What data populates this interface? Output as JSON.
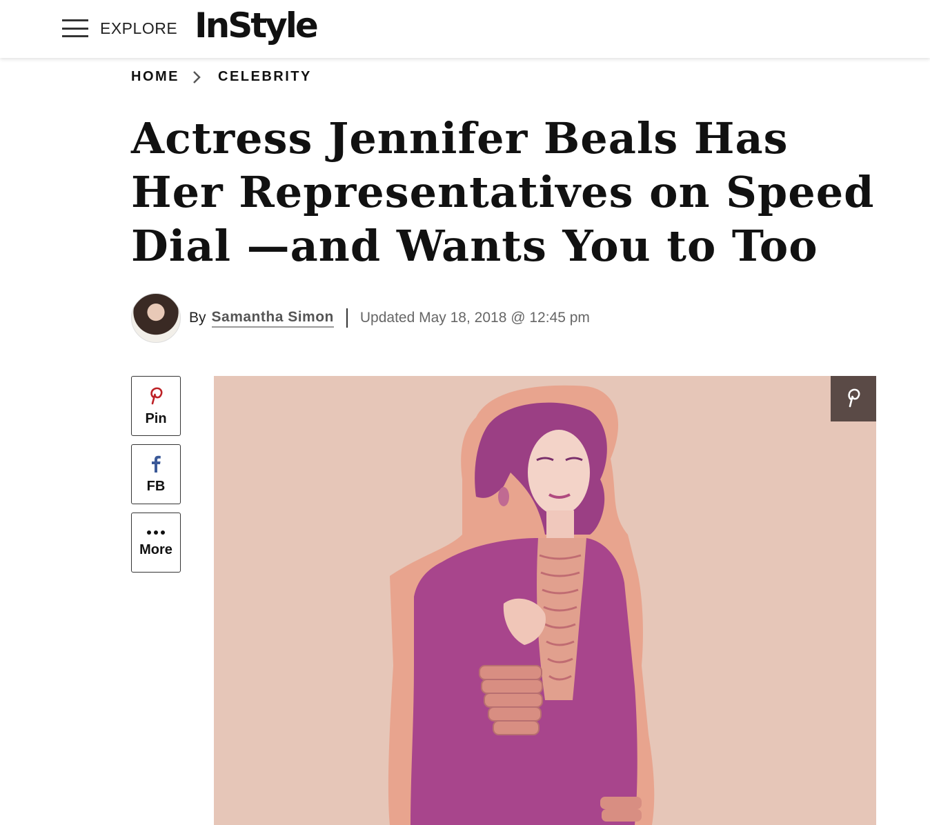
{
  "header": {
    "explore_label": "EXPLORE",
    "logo_text": "InStyle"
  },
  "breadcrumb": {
    "home": "HOME",
    "section": "CELEBRITY"
  },
  "article": {
    "headline": "Actress Jennifer Beals Has Her Representatives on Speed Dial —and Wants You to Too",
    "by_prefix": "By",
    "author": "Samantha Simon",
    "updated": "Updated May 18, 2018 @ 12:45 pm"
  },
  "share": {
    "pin_label": "Pin",
    "fb_label": "FB",
    "more_label": "More"
  },
  "colors": {
    "pinterest": "#bd2126",
    "facebook": "#3b5998",
    "hero_bg": "#e6c6b8",
    "figure_magenta": "#a8458c",
    "pin_overlay": "#5a4a46"
  },
  "icons": {
    "menu": "hamburger-icon",
    "breadcrumb_sep": "chevron-right-icon",
    "pin": "pinterest-icon",
    "fb": "facebook-icon",
    "more": "ellipsis-icon",
    "hero_pin": "pinterest-icon"
  }
}
